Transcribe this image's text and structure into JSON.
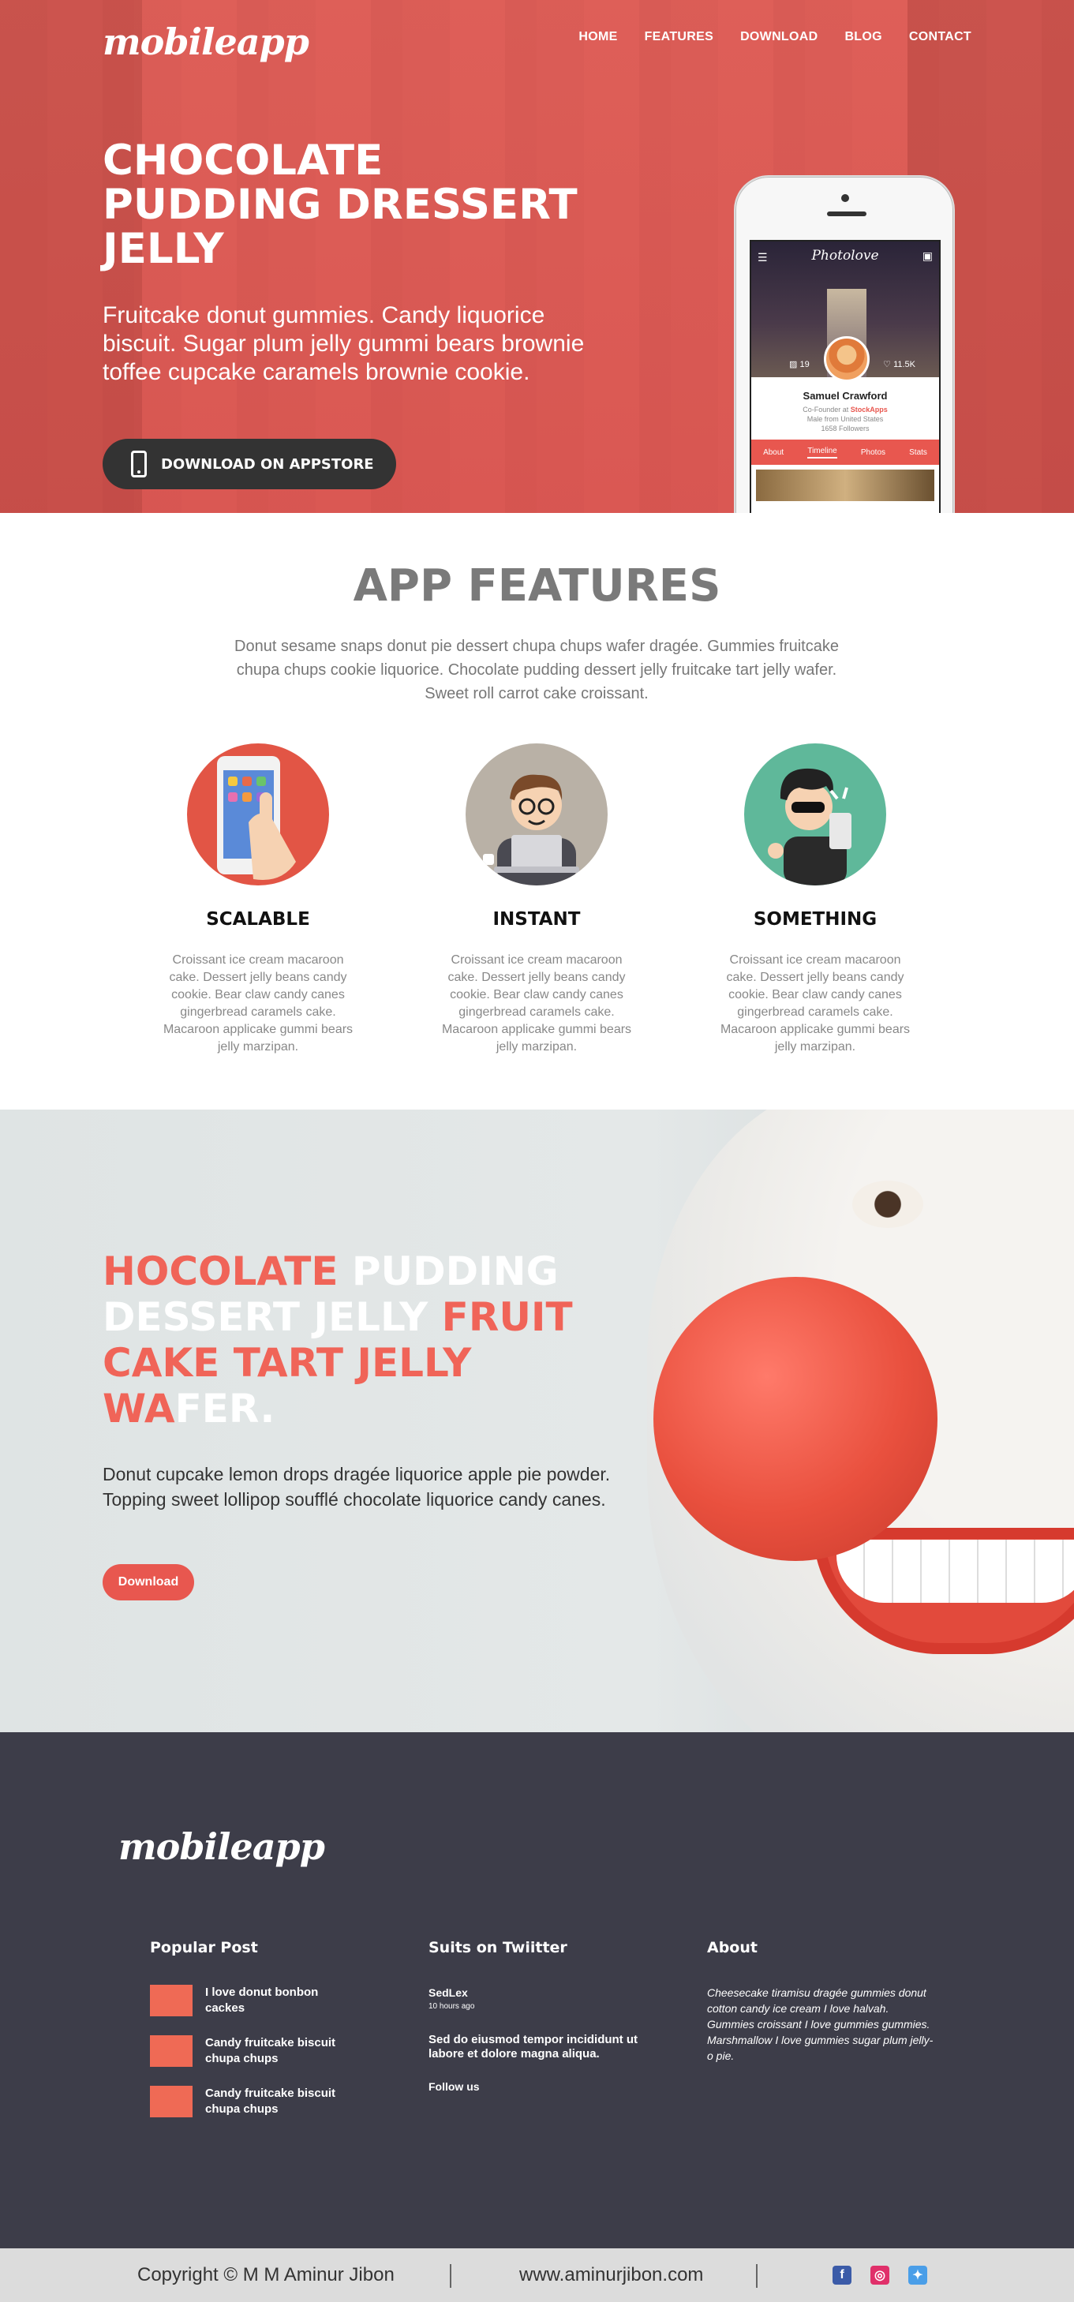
{
  "nav": {
    "logo": "mobileapp",
    "links": [
      "HOME",
      "FEATURES",
      "DOWNLOAD",
      "BLOG",
      "CONTACT"
    ]
  },
  "hero": {
    "title": "CHOCOLATE PUDDING DRESSERT JELLY",
    "subtitle": "Fruitcake donut gummies. Candy liquorice biscuit. Sugar plum jelly gummi bears brownie toffee cupcake caramels brownie cookie.",
    "button_label": "DOWNLOAD ON APPSTORE",
    "phone": {
      "app_name": "Photolove",
      "photos_count": "19",
      "likes_count": "11.5K",
      "profile_name": "Samuel Crawford",
      "role_prefix": "Co-Founder at ",
      "role_company": "StockApps",
      "location": "Male from United States",
      "followers": "1658 Followers",
      "tabs": [
        "About",
        "Timeline",
        "Photos",
        "Stats"
      ]
    }
  },
  "features": {
    "heading": "APP FEATURES",
    "intro": "Donut sesame snaps donut pie dessert chupa chups wafer dragée. Gummies fruitcake chupa chups cookie liquorice. Chocolate pudding dessert jelly fruitcake tart jelly wafer. Sweet roll carrot cake croissant.",
    "items": [
      {
        "title": "SCALABLE",
        "text": "Croissant ice cream macaroon cake. Dessert jelly beans candy cookie. Bear claw candy canes gingerbread caramels cake. Macaroon applicake gummi bears jelly marzipan."
      },
      {
        "title": "INSTANT",
        "text": "Croissant ice cream macaroon cake. Dessert jelly beans candy cookie. Bear claw candy canes gingerbread caramels cake. Macaroon applicake gummi bears jelly marzipan."
      },
      {
        "title": "SOMETHING",
        "text": "Croissant ice cream macaroon cake. Dessert jelly beans candy cookie. Bear claw candy canes gingerbread caramels cake. Macaroon applicake gummi bears jelly marzipan."
      }
    ]
  },
  "promo": {
    "heading_parts": [
      {
        "text": "HOCOLATE ",
        "color": "red"
      },
      {
        "text": "PUDDING DESSERT JELLY ",
        "color": "white"
      },
      {
        "text": "FRUIT CAKE TART JELLY WA",
        "color": "red"
      },
      {
        "text": "FER.",
        "color": "white"
      }
    ],
    "description": "Donut cupcake lemon drops dragée liquorice apple pie powder. Topping sweet lollipop soufflé chocolate liquorice candy canes.",
    "button_label": "Download"
  },
  "footer": {
    "logo": "mobileapp",
    "popular": {
      "heading": "Popular Post",
      "posts": [
        "I love donut bonbon cackes",
        "Candy fruitcake biscuit chupa chups",
        "Candy fruitcake biscuit chupa chups"
      ]
    },
    "twitter": {
      "heading": "Suits on Twiitter",
      "handle": "SedLex",
      "time": "10 hours ago",
      "text": "Sed do eiusmod tempor incididunt ut labore et dolore magna aliqua.",
      "follow": "Follow us"
    },
    "about": {
      "heading": "About",
      "text": "Cheesecake tiramisu dragée gummies donut cotton candy ice cream I love halvah. Gummies croissant I love gummies gummies. Marshmallow I love gummies sugar plum jelly-o pie."
    }
  },
  "copyright": {
    "text": "Copyright © M M Aminur Jibon",
    "site": "www.aminurjibon.com",
    "social": [
      "facebook-icon",
      "instagram-icon",
      "twitter-icon"
    ]
  },
  "colors": {
    "accent": "#e8574f",
    "footer_bg": "#3d3d49",
    "copy_bg": "#dcdcdc"
  }
}
